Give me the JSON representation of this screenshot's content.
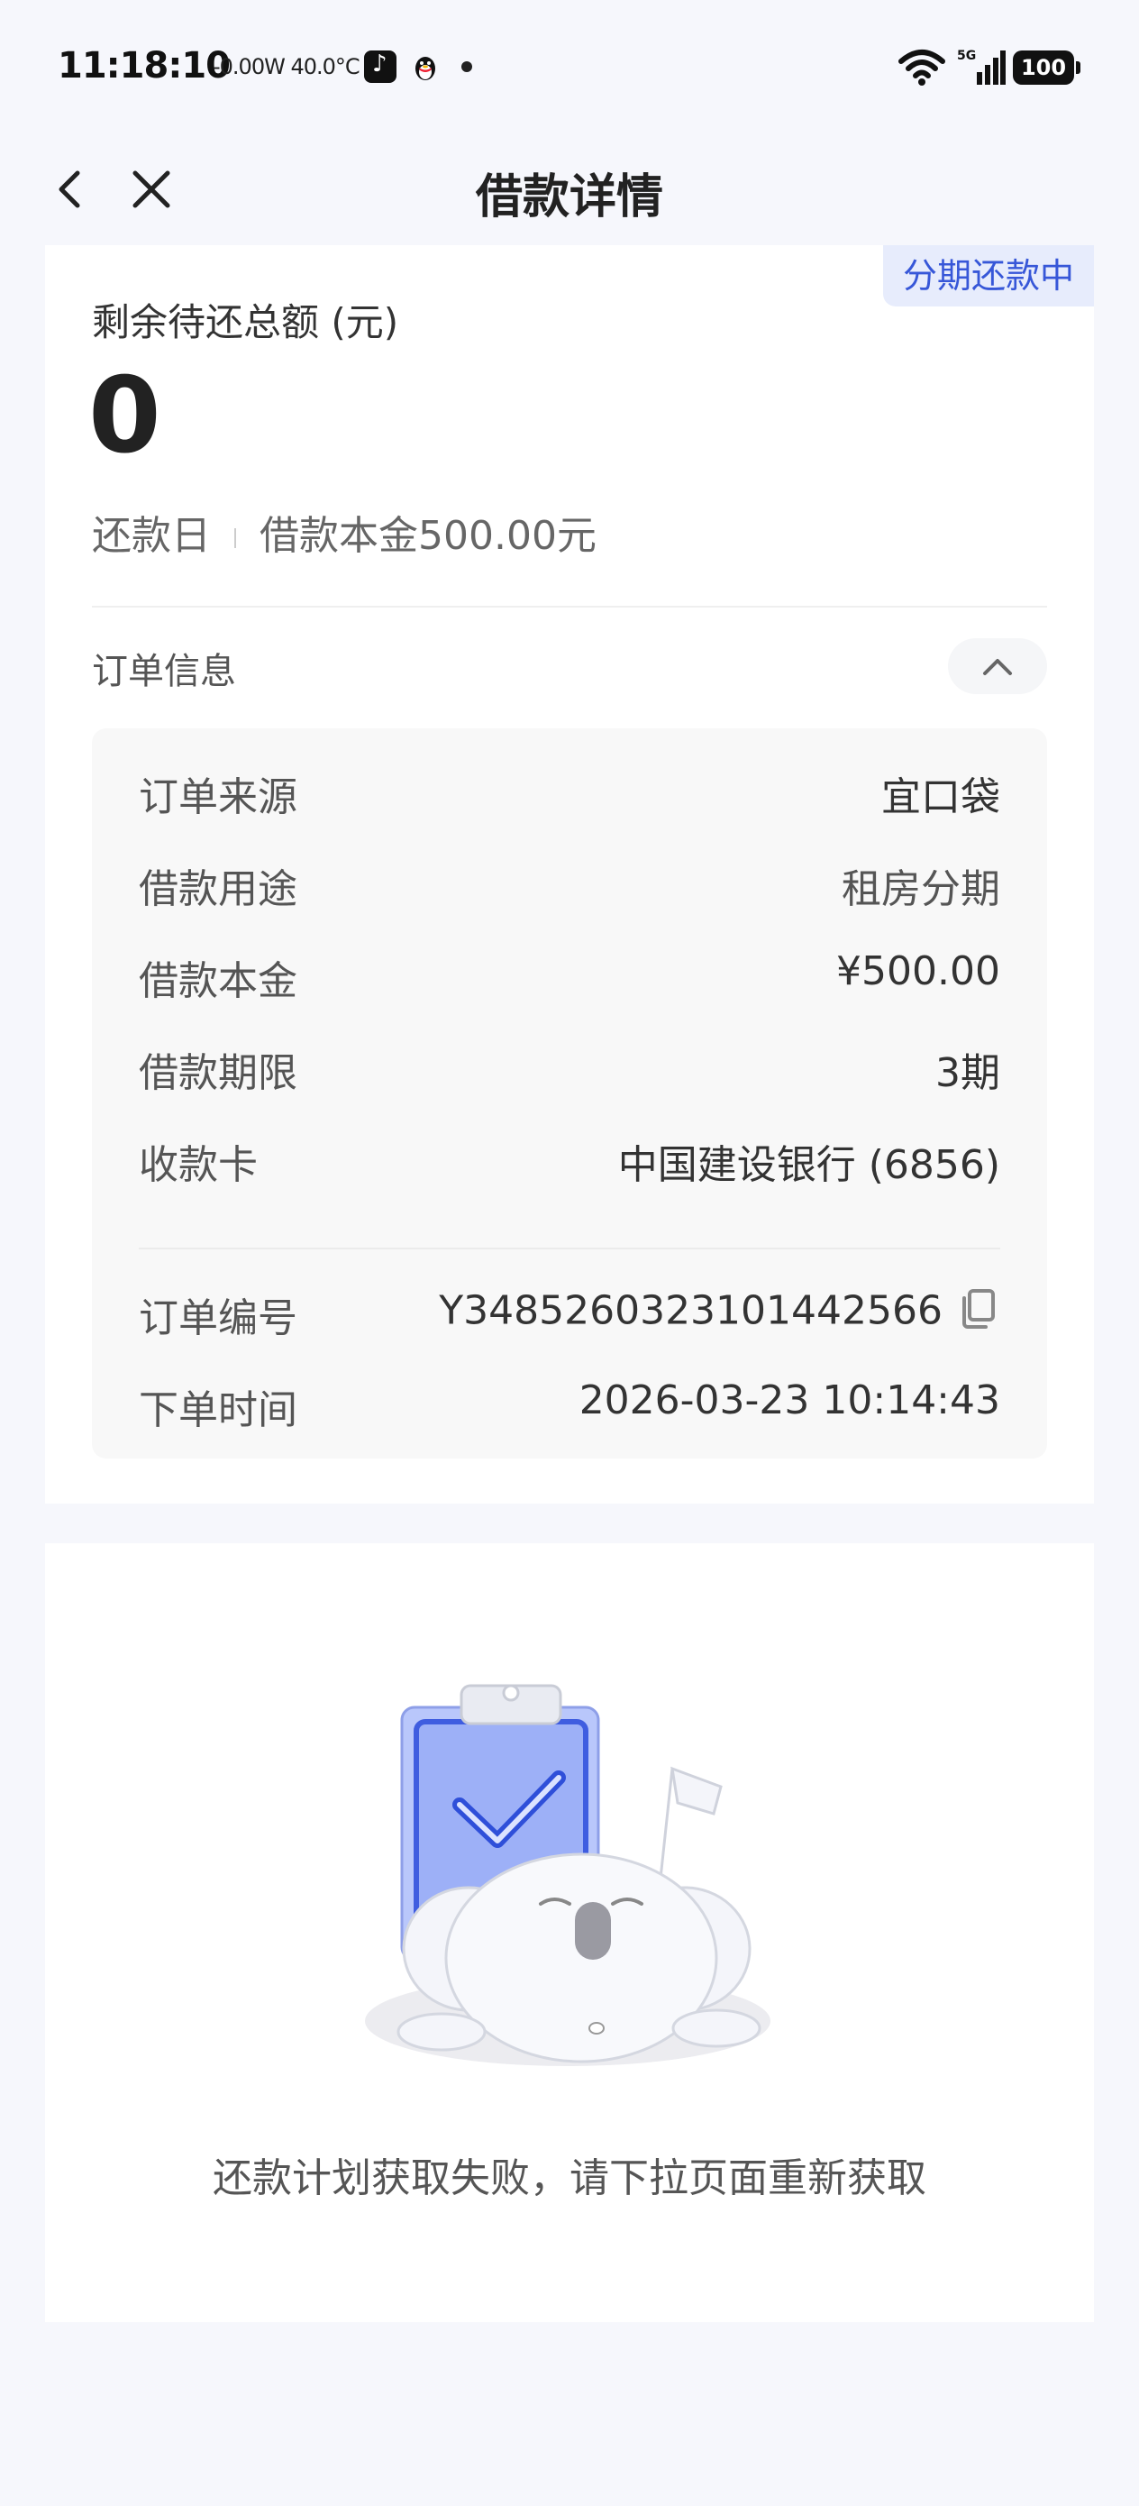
{
  "status_bar": {
    "time": "11:18:10",
    "metrics": "-0.00W 40.0°C",
    "battery": "100",
    "network": "5G"
  },
  "nav": {
    "title": "借款详情"
  },
  "summary": {
    "status_tag": "分期还款中",
    "remaining_label": "剩余待还总额 (元)",
    "remaining_value": "0",
    "repay_day_label": "还款日",
    "principal_text": "借款本金500.00元"
  },
  "order_info": {
    "section_label": "订单信息",
    "rows": [
      {
        "label": "订单来源",
        "value": "宜口袋"
      },
      {
        "label": "借款用途",
        "value": "租房分期"
      },
      {
        "label": "借款本金",
        "value": "¥500.00"
      },
      {
        "label": "借款期限",
        "value": "3期"
      },
      {
        "label": "收款卡",
        "value": "中国建设银行 (6856)"
      },
      {
        "label": "订单编号",
        "value": "Y3485260323101442566"
      },
      {
        "label": "下单时间",
        "value": "2026-03-23 10:14:43"
      }
    ]
  },
  "plan": {
    "empty_message": "还款计划获取失败，请下拉页面重新获取"
  },
  "colors": {
    "accent": "#3757d8",
    "tag_bg": "#e7ecfc",
    "page_bg": "#f6f7fc"
  }
}
